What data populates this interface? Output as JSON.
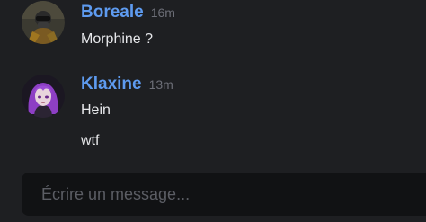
{
  "messages": [
    {
      "username": "Boreale",
      "timestamp": "16m",
      "lines": [
        "Morphine ?"
      ]
    },
    {
      "username": "Klaxine",
      "timestamp": "13m",
      "lines": [
        "Hein",
        "wtf"
      ]
    }
  ],
  "composer": {
    "placeholder": "Écrire un message..."
  },
  "colors": {
    "background": "#1e1f22",
    "username": "#5e9bf0",
    "composer_bg": "#111214"
  },
  "icons": {
    "boreale_avatar": "masked-soldier-avatar",
    "klaxine_avatar": "purple-hair-anime-avatar"
  }
}
